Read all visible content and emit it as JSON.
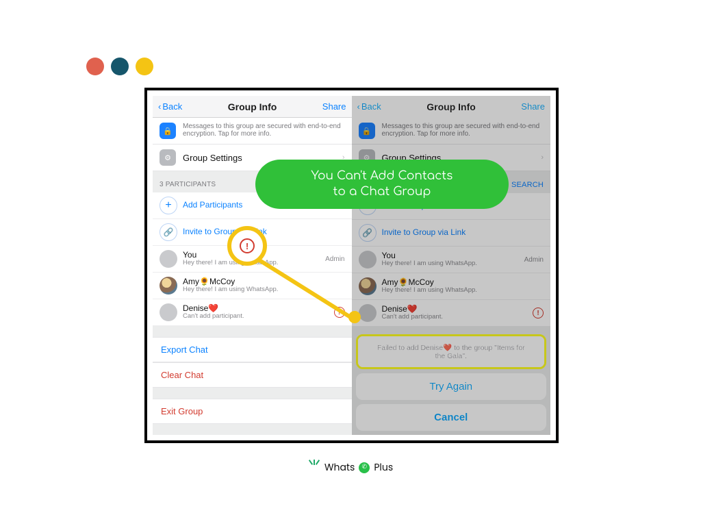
{
  "overlay": {
    "pill_line1": "You Can't Add Contacts",
    "pill_line2": "to a Chat Group"
  },
  "header": {
    "back": "Back",
    "title": "Group Info",
    "share": "Share"
  },
  "encryption_note": "Messages to this group are secured with end-to-end encryption. Tap for more info.",
  "group_settings": "Group Settings",
  "participants_label": "3 PARTICIPANTS",
  "search_label": "SEARCH",
  "actions": {
    "add": "Add Participants",
    "invite": "Invite to Group via Link"
  },
  "members": [
    {
      "name": "You",
      "sub": "Hey there! I am using WhatsApp.",
      "badge": "Admin"
    },
    {
      "name": "Amy🌻McCoy",
      "sub": "Hey there! I am using WhatsApp."
    },
    {
      "name": "Denise❤️",
      "sub": "Can't add participant.",
      "error": true
    }
  ],
  "bottom": {
    "export": "Export Chat",
    "clear": "Clear Chat",
    "exit": "Exit Group"
  },
  "alert": {
    "message": "Failed to add Denise❤️ to the group \"Items for the Gala\".",
    "try_again": "Try Again",
    "cancel": "Cancel"
  },
  "footer": {
    "left": "Whats",
    "right": "Plus"
  },
  "left_invite_short": "Invite to Group via Link",
  "left_you_sub_short": "Hey there! I am using WhatsApp."
}
